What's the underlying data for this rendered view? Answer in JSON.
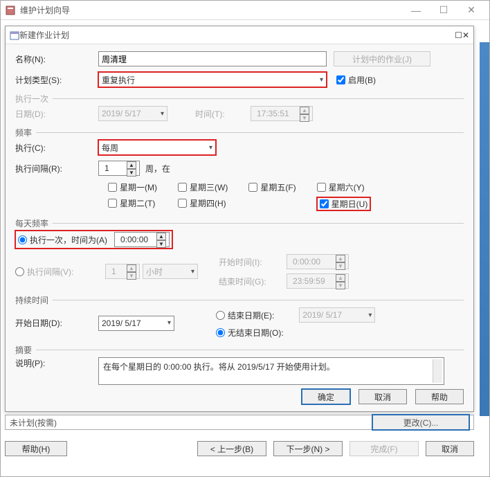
{
  "outer": {
    "title": "维护计划向导",
    "status": "未计划(按需)",
    "change_btn": "更改(C)...",
    "help": "帮助(H)",
    "prev": "< 上一步(B)",
    "next": "下一步(N) >",
    "finish": "完成(F)",
    "cancel": "取消"
  },
  "inner": {
    "title": "新建作业计划",
    "name_lbl": "名称(N):",
    "name_val": "周清理",
    "plan_jobs_btn": "计划中的作业(J)",
    "type_lbl": "计划类型(S):",
    "type_val": "重复执行",
    "enable_lbl": "启用(B)",
    "once_grp": "执行一次",
    "date_lbl": "日期(D):",
    "date_val": "2019/ 5/17",
    "time_lbl": "时间(T):",
    "time_val": "17:35:51",
    "freq_grp": "频率",
    "exec_lbl": "执行(C):",
    "exec_val": "每周",
    "interval_lbl": "执行间隔(R):",
    "interval_val": "1",
    "interval_after": "周，在",
    "days": {
      "mon": "星期一(M)",
      "wed": "星期三(W)",
      "fri": "星期五(F)",
      "sat": "星期六(Y)",
      "tue": "星期二(T)",
      "thu": "星期四(H)",
      "sun": "星期日(U)"
    },
    "dayfreq_grp": "每天频率",
    "once_at_lbl": "执行一次，时间为(A)",
    "once_at_val": "0:00:00",
    "interval2_lbl": "执行间隔(V):",
    "interval2_val": "1",
    "interval2_unit": "小时",
    "start_lbl": "开始时间(I):",
    "start_val": "0:00:00",
    "end_lbl": "结束时间(G):",
    "end_val": "23:59:59",
    "dur_grp": "持续时间",
    "startd_lbl": "开始日期(D):",
    "endd_lbl": "结束日期(E):",
    "noend_lbl": "无结束日期(O):",
    "summary_grp": "摘要",
    "desc_lbl": "说明(P):",
    "desc_val": "在每个星期日的 0:00:00 执行。将从 2019/5/17 开始使用计划。",
    "ok": "确定",
    "cancel": "取消",
    "help": "帮助"
  }
}
